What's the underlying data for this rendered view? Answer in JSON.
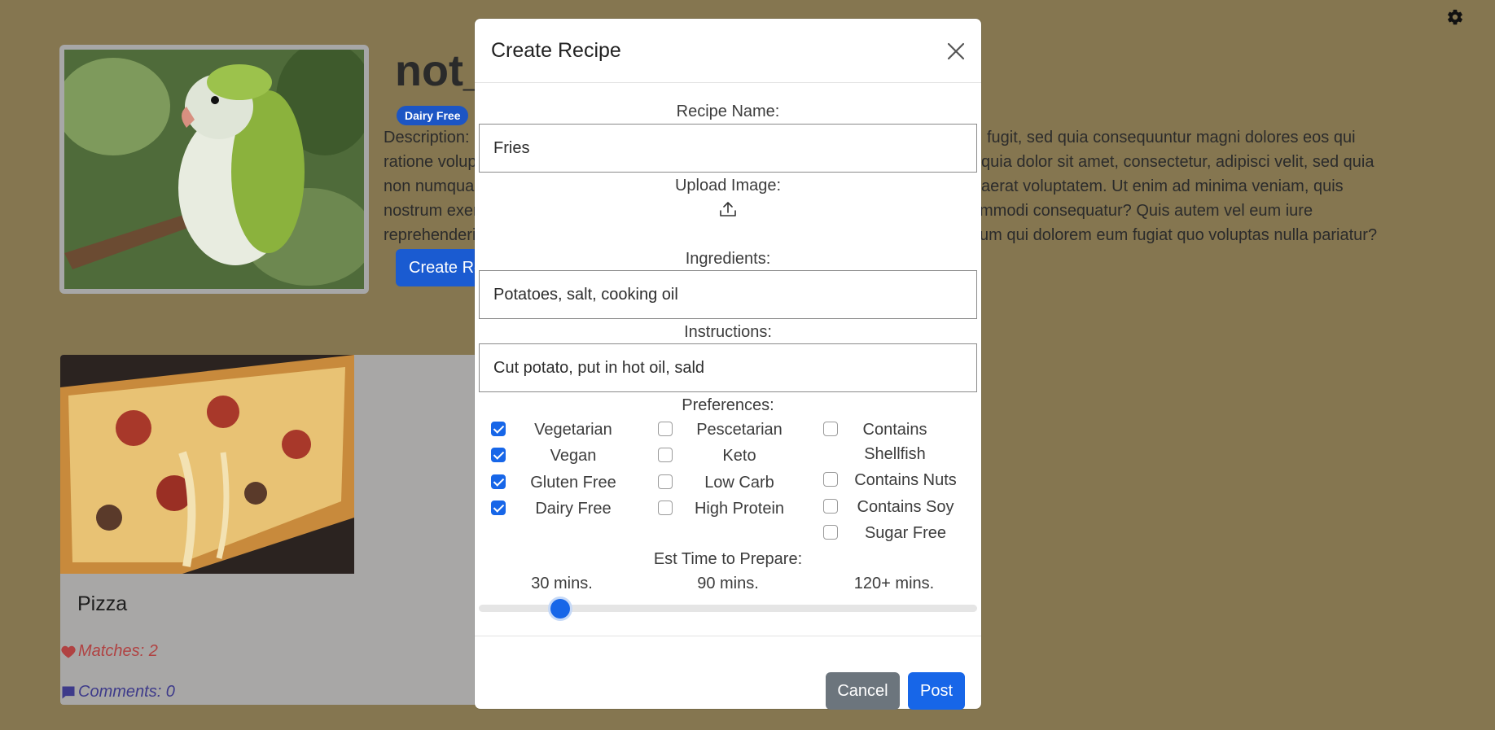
{
  "background": {
    "username": "not_",
    "badge": "Dairy Free",
    "description_label": "Description:",
    "description_lines_left": [
      "ratione volup",
      "non numqua",
      "nostrum exer",
      "reprehenderi"
    ],
    "description_lines_right": [
      "fugit, sed quia consequuntur magni dolores eos qui",
      "quia dolor sit amet, consectetur, adipisci velit, sed quia",
      "aerat voluptatem. Ut enim ad minima veniam, quis",
      "mmodi consequatur? Quis autem vel eum iure",
      "um qui dolorem eum fugiat quo voluptas nulla pariatur?"
    ],
    "create_button": "Create Re",
    "card": {
      "title": "Pizza",
      "matches": "Matches: 2",
      "comments": "Comments: 0"
    }
  },
  "modal": {
    "title": "Create Recipe",
    "recipe_name_label": "Recipe Name:",
    "recipe_name_value": "Fries",
    "upload_label": "Upload Image:",
    "ingredients_label": "Ingredients:",
    "ingredients_value": "Potatoes, salt, cooking oil",
    "instructions_label": "Instructions:",
    "instructions_value": "Cut potato, put in hot oil, sald",
    "preferences_label": "Preferences:",
    "preferences": [
      {
        "label": "Vegetarian",
        "checked": true
      },
      {
        "label": "Vegan",
        "checked": true
      },
      {
        "label": "Gluten Free",
        "checked": true
      },
      {
        "label": "Dairy Free",
        "checked": true
      },
      {
        "label": "Pescetarian",
        "checked": false
      },
      {
        "label": "Keto",
        "checked": false
      },
      {
        "label": "Low Carb",
        "checked": false
      },
      {
        "label": "High Protein",
        "checked": false
      },
      {
        "label": "Contains Shellfish",
        "checked": false
      },
      {
        "label": "Contains Nuts",
        "checked": false
      },
      {
        "label": "Contains Soy",
        "checked": false
      },
      {
        "label": "Sugar Free",
        "checked": false
      }
    ],
    "time_label": "Est Time to Prepare:",
    "time_ticks": [
      "30 mins.",
      "90 mins.",
      "120+ mins."
    ],
    "time_slider_fraction": 0.15,
    "cancel": "Cancel",
    "post": "Post",
    "accent_color": "#1766e8"
  }
}
